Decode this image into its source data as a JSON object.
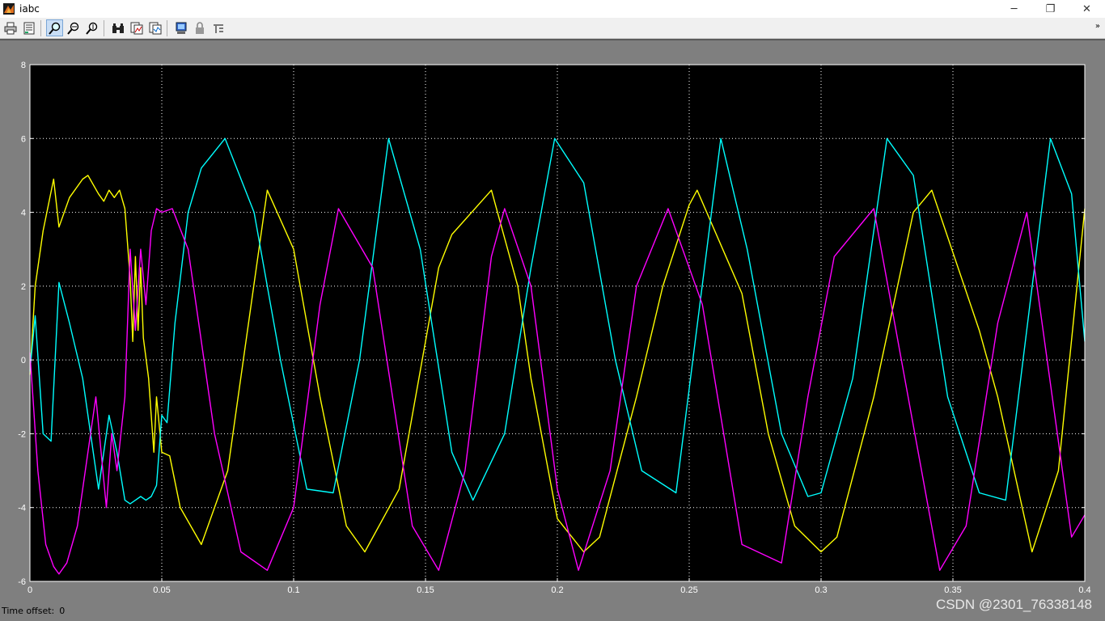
{
  "window": {
    "title": "iabc",
    "controls": {
      "minimize": "─",
      "restore": "❐",
      "close": "✕"
    }
  },
  "toolbar": {
    "buttons": [
      {
        "icon": "print-icon"
      },
      {
        "icon": "parameters-icon"
      },
      {
        "icon": "zoom-icon",
        "active": true
      },
      {
        "icon": "zoom-x-icon"
      },
      {
        "icon": "zoom-y-icon"
      },
      {
        "icon": "autoscale-binoculars-icon"
      },
      {
        "icon": "save-axes-icon"
      },
      {
        "icon": "restore-axes-icon"
      },
      {
        "icon": "floating-scope-icon"
      },
      {
        "icon": "lock-axes-icon"
      },
      {
        "icon": "signal-selection-icon"
      }
    ],
    "overflow_glyph": "»"
  },
  "status": {
    "time_offset_label": "Time offset:",
    "time_offset_value": "0"
  },
  "watermark": "CSDN @2301_76338148",
  "colors": {
    "background": "#000000",
    "axis_frame": "#ffffff",
    "grid": "#ffffff",
    "series_a": "#ffff00",
    "series_b": "#00ffff",
    "series_c": "#ff00ff"
  },
  "chart_data": {
    "type": "line",
    "title": "",
    "xlabel": "",
    "ylabel": "",
    "xlim": [
      0,
      0.4
    ],
    "ylim": [
      -6,
      8
    ],
    "grid": true,
    "grid_style": "dotted",
    "xticks": [
      0,
      0.05,
      0.1,
      0.15,
      0.2,
      0.25,
      0.3,
      0.35,
      0.4
    ],
    "xtick_labels": [
      "0",
      "0.05",
      "0.1",
      "0.15",
      "0.2",
      "0.25",
      "0.3",
      "0.35",
      "0.4"
    ],
    "yticks": [
      -6,
      -4,
      -2,
      0,
      2,
      4,
      6,
      8
    ],
    "ytick_labels": [
      "-6",
      "-4",
      "-2",
      "0",
      "2",
      "4",
      "6",
      "8"
    ],
    "series": [
      {
        "color": "#ffff00",
        "steady_state_peak": 4.6,
        "steady_state_trough": -5.2,
        "x": [
          0,
          0.002,
          0.005,
          0.009,
          0.011,
          0.015,
          0.02,
          0.022,
          0.026,
          0.028,
          0.03,
          0.032,
          0.034,
          0.036,
          0.038,
          0.039,
          0.04,
          0.041,
          0.042,
          0.043,
          0.045,
          0.047,
          0.048,
          0.05,
          0.053,
          0.057,
          0.065,
          0.075,
          0.09,
          0.1,
          0.11,
          0.12,
          0.127,
          0.14,
          0.155,
          0.16,
          0.175,
          0.185,
          0.19,
          0.2,
          0.21,
          0.216,
          0.23,
          0.24,
          0.25,
          0.253,
          0.27,
          0.28,
          0.29,
          0.3,
          0.306,
          0.32,
          0.335,
          0.342,
          0.36,
          0.367,
          0.38,
          0.39,
          0.4
        ],
        "y": [
          -0.4,
          2.0,
          3.5,
          4.9,
          3.6,
          4.4,
          4.9,
          5.0,
          4.5,
          4.3,
          4.6,
          4.4,
          4.6,
          4.1,
          2.2,
          0.5,
          2.8,
          0.8,
          2.5,
          0.6,
          -0.5,
          -2.5,
          -1.0,
          -2.5,
          -2.6,
          -4.0,
          -5.0,
          -3.0,
          4.6,
          3.0,
          -1.0,
          -4.5,
          -5.2,
          -3.5,
          2.5,
          3.4,
          4.6,
          2.0,
          -0.5,
          -4.3,
          -5.2,
          -4.8,
          -1.0,
          2.0,
          4.2,
          4.6,
          1.8,
          -2.0,
          -4.5,
          -5.2,
          -4.8,
          -1.0,
          4.0,
          4.6,
          0.8,
          -1.0,
          -5.2,
          -3.0,
          4.1
        ]
      },
      {
        "color": "#00ffff",
        "steady_state_peak": 6.0,
        "steady_state_trough": -3.8,
        "x": [
          0,
          0.002,
          0.005,
          0.008,
          0.011,
          0.015,
          0.02,
          0.026,
          0.03,
          0.033,
          0.036,
          0.038,
          0.04,
          0.042,
          0.044,
          0.046,
          0.048,
          0.05,
          0.052,
          0.055,
          0.06,
          0.065,
          0.074,
          0.085,
          0.095,
          0.105,
          0.115,
          0.125,
          0.136,
          0.148,
          0.16,
          0.168,
          0.18,
          0.19,
          0.199,
          0.21,
          0.222,
          0.232,
          0.245,
          0.262,
          0.272,
          0.285,
          0.295,
          0.3,
          0.312,
          0.325,
          0.335,
          0.348,
          0.36,
          0.37,
          0.387,
          0.395,
          0.4
        ],
        "y": [
          -0.3,
          1.2,
          -2.0,
          -2.2,
          2.1,
          1.0,
          -0.5,
          -3.5,
          -1.5,
          -2.5,
          -3.8,
          -3.9,
          -3.8,
          -3.7,
          -3.8,
          -3.7,
          -3.4,
          -1.5,
          -1.7,
          1.0,
          4.0,
          5.2,
          6.0,
          4.0,
          0.0,
          -3.5,
          -3.6,
          0.0,
          6.0,
          3.0,
          -2.5,
          -3.8,
          -2.0,
          2.5,
          6.0,
          4.8,
          0.0,
          -3.0,
          -3.6,
          6.0,
          3.0,
          -2.0,
          -3.7,
          -3.6,
          -0.5,
          6.0,
          5.0,
          -1.0,
          -3.6,
          -3.8,
          6.0,
          4.5,
          0.5
        ]
      },
      {
        "color": "#ff00ff",
        "steady_state_peak": 4.1,
        "steady_state_trough": -5.7,
        "x": [
          0,
          0.003,
          0.006,
          0.009,
          0.011,
          0.014,
          0.018,
          0.022,
          0.025,
          0.027,
          0.029,
          0.031,
          0.033,
          0.036,
          0.038,
          0.04,
          0.042,
          0.044,
          0.046,
          0.048,
          0.05,
          0.054,
          0.06,
          0.07,
          0.08,
          0.09,
          0.1,
          0.11,
          0.117,
          0.13,
          0.145,
          0.155,
          0.165,
          0.175,
          0.18,
          0.19,
          0.2,
          0.208,
          0.22,
          0.23,
          0.242,
          0.255,
          0.27,
          0.285,
          0.295,
          0.305,
          0.32,
          0.333,
          0.345,
          0.355,
          0.367,
          0.378,
          0.395,
          0.4
        ],
        "y": [
          0.2,
          -3.0,
          -5.0,
          -5.6,
          -5.8,
          -5.5,
          -4.5,
          -2.5,
          -1.0,
          -2.5,
          -4.0,
          -2.0,
          -3.0,
          -1.0,
          3.0,
          0.8,
          3.0,
          1.5,
          3.5,
          4.1,
          4.0,
          4.1,
          3.0,
          -2.0,
          -5.2,
          -5.7,
          -4.0,
          1.5,
          4.1,
          2.5,
          -4.5,
          -5.7,
          -3.0,
          2.8,
          4.1,
          2.0,
          -3.5,
          -5.7,
          -3.0,
          2.0,
          4.1,
          1.5,
          -5.0,
          -5.5,
          -1.0,
          2.8,
          4.1,
          -1.0,
          -5.7,
          -4.5,
          1.0,
          4.0,
          -4.8,
          -4.2
        ]
      }
    ]
  }
}
